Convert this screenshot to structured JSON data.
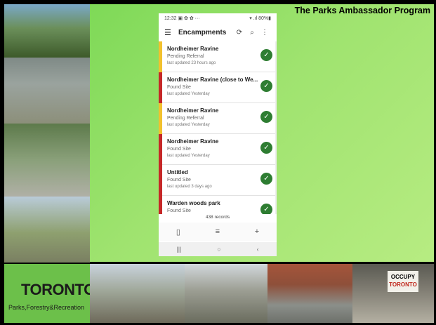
{
  "slide": {
    "title": "The Parks Ambassador Program",
    "logo_word": "TORONTO",
    "logo_sub": "Parks,Forestry&Recreation",
    "sign_line1": "OCCUPY",
    "sign_line2": "TORONTO"
  },
  "phone": {
    "status_time": "12:32",
    "status_icons": "▣ ✿ ✿ ···",
    "status_right": "▾ .ıl 80%▮",
    "app_title": "Encampments",
    "menu_icon": "☰",
    "sync_icon": "⟳",
    "search_icon": "⌕",
    "more_icon": "⋮",
    "rows": [
      {
        "name": "Nordheimer Ravine",
        "status": "Pending Referral",
        "updated": "last updated 23 hours ago",
        "color": "#f2c12e"
      },
      {
        "name": "Nordheimer Ravine (close to We...",
        "status": "Found Site",
        "updated": "last updated Yesterday",
        "color": "#c62828"
      },
      {
        "name": "Nordheimer Ravine",
        "status": "Pending Referral",
        "updated": "last updated Yesterday",
        "color": "#f2c12e"
      },
      {
        "name": "Nordheimer Ravine",
        "status": "Found Site",
        "updated": "last updated Yesterday",
        "color": "#c62828"
      },
      {
        "name": "Untitled",
        "status": "Found Site",
        "updated": "last updated 3 days ago",
        "color": "#c62828"
      },
      {
        "name": "Warden woods park",
        "status": "Found Site",
        "updated": "",
        "color": "#c62828"
      }
    ],
    "records": "438 records",
    "toolbar": {
      "map_icon": "▯",
      "filter_icon": "≡",
      "add_icon": "+"
    },
    "navbar": {
      "recent": "|||",
      "home": "○",
      "back": "‹"
    }
  }
}
